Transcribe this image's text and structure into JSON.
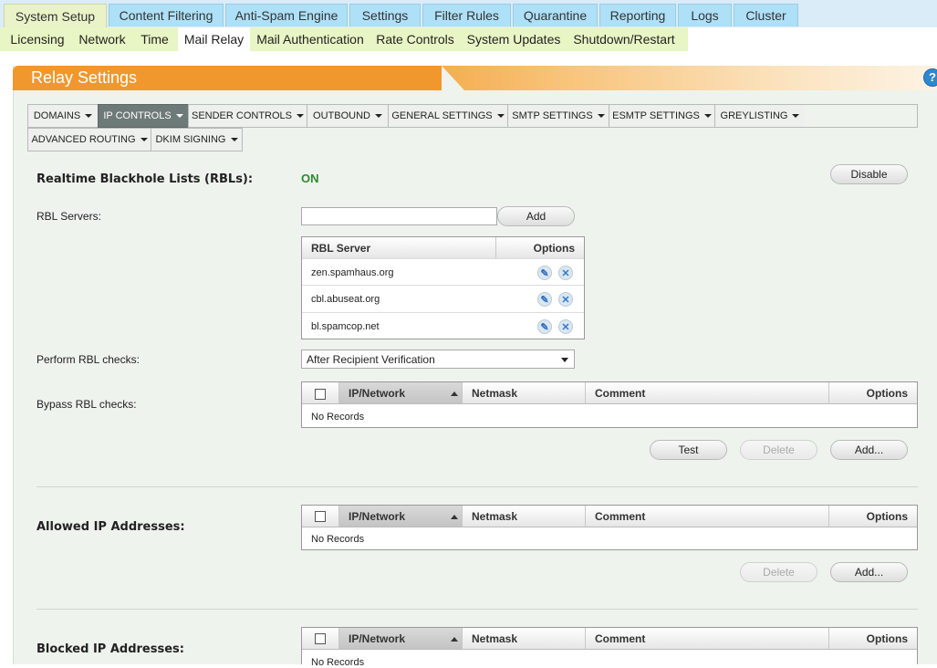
{
  "top_tabs": [
    "System Setup",
    "Content Filtering",
    "Anti-Spam Engine",
    "Settings",
    "Filter Rules",
    "Quarantine",
    "Reporting",
    "Logs",
    "Cluster"
  ],
  "sub_tabs": [
    "Licensing",
    "Network",
    "Time",
    "Mail Relay",
    "Mail Authentication",
    "Rate Controls",
    "System Updates",
    "Shutdown/Restart"
  ],
  "panel": {
    "title": "Relay Settings",
    "help": "?"
  },
  "menu": [
    "DOMAINS",
    "IP CONTROLS",
    "SENDER CONTROLS",
    "OUTBOUND",
    "GENERAL SETTINGS",
    "SMTP SETTINGS",
    "ESMTP SETTINGS",
    "GREYLISTING",
    "ADVANCED ROUTING",
    "DKIM SIGNING"
  ],
  "rbl": {
    "label": "Realtime Blackhole Lists (RBLs):",
    "status": "ON",
    "status_color": "#2e8b2e",
    "toggle_label": "Disable",
    "servers_label": "RBL Servers:",
    "server_input_value": "",
    "add_label": "Add",
    "table_headers": {
      "server": "RBL Server",
      "options": "Options"
    },
    "servers": [
      "zen.spamhaus.org",
      "cbl.abuseat.org",
      "bl.spamcop.net"
    ],
    "perform_label": "Perform RBL checks:",
    "perform_value": "After Recipient Verification",
    "bypass_label": "Bypass RBL checks:"
  },
  "ip_table_headers": {
    "ip": "IP/Network",
    "netmask": "Netmask",
    "comment": "Comment",
    "options": "Options"
  },
  "no_records": "No Records",
  "buttons": {
    "test": "Test",
    "delete": "Delete",
    "add": "Add..."
  },
  "allowed": {
    "label": "Allowed IP Addresses:"
  },
  "blocked": {
    "label": "Blocked IP Addresses:"
  }
}
